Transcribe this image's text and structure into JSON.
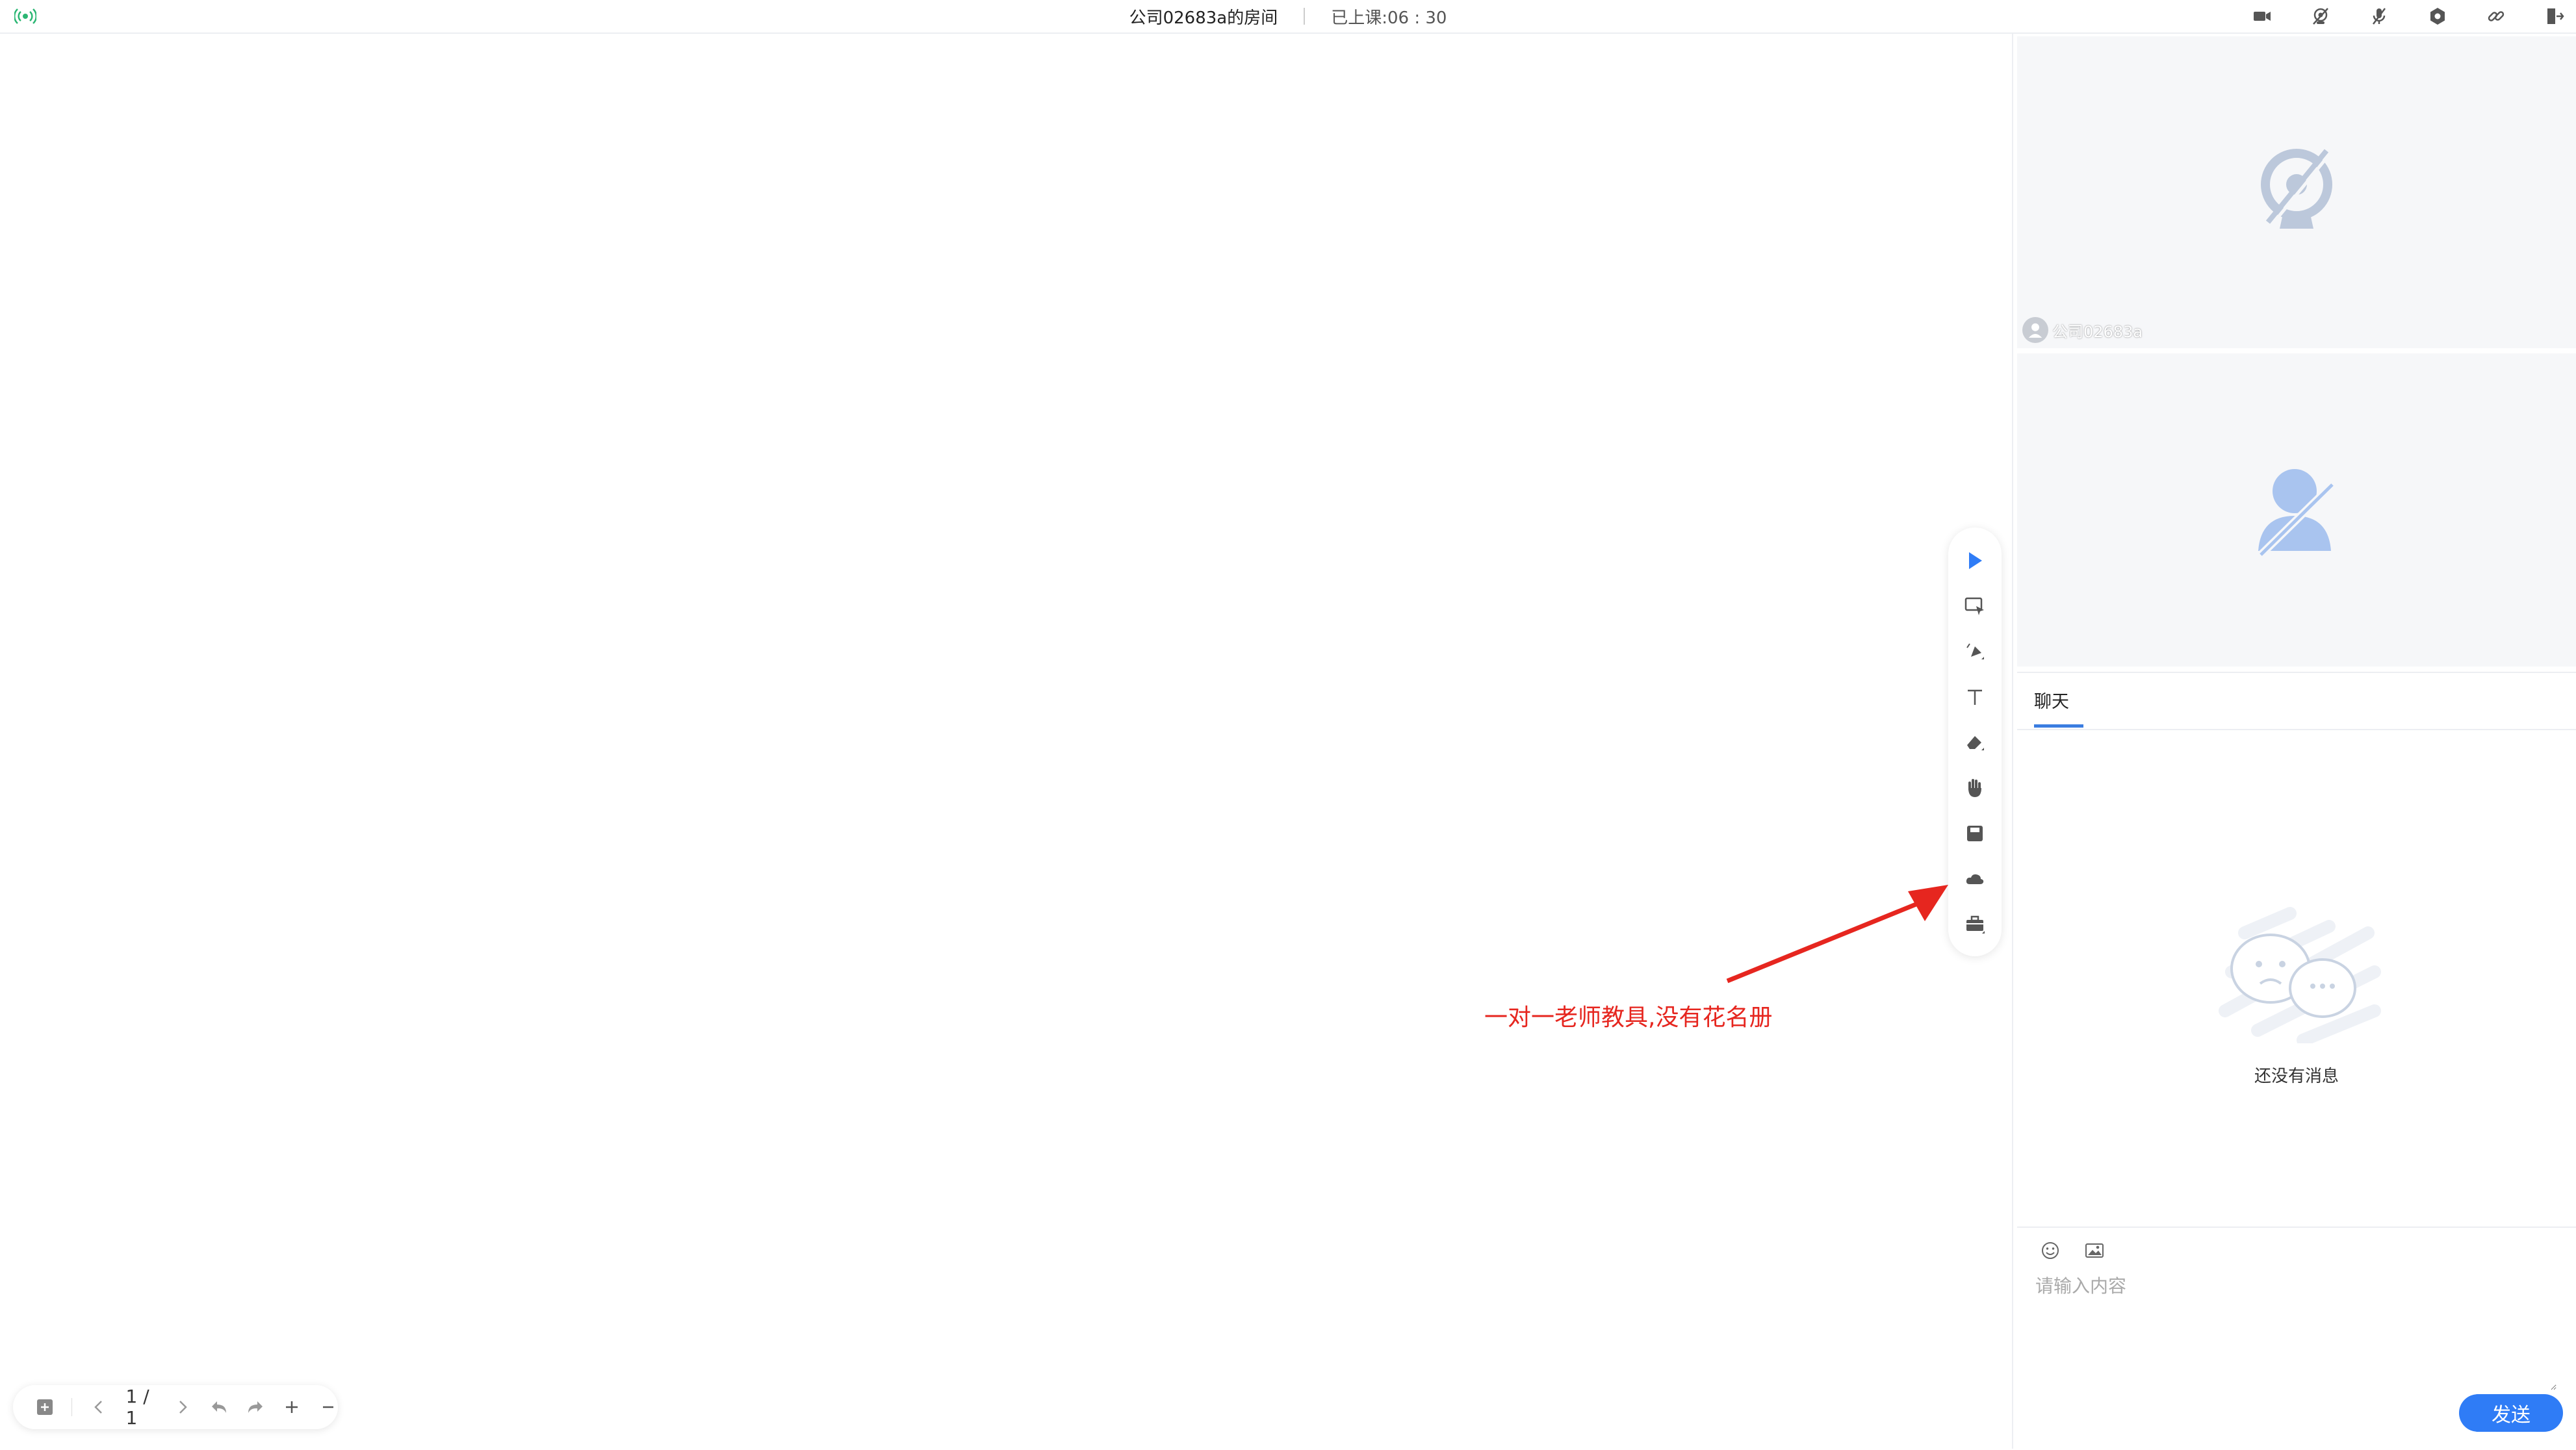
{
  "header": {
    "room_title": "公司02683a的房间",
    "timer_label": "已上课:06 : 30",
    "icons": [
      "signal-icon",
      "camera-icon",
      "camera-off-icon",
      "mic-off-icon",
      "settings-icon",
      "link-icon",
      "exit-icon"
    ]
  },
  "whiteboard": {
    "toolbar_icons": [
      "pointer-icon",
      "select-icon",
      "pen-icon",
      "text-icon",
      "eraser-icon",
      "hand-icon",
      "save-icon",
      "cloud-icon",
      "toolbox-icon"
    ],
    "annotation": "一对一老师教具,没有花名册",
    "pager": {
      "page_text": "1 / 1"
    }
  },
  "videos": [
    {
      "name": "公司02683a",
      "state_icon": "camera-off-icon"
    },
    {
      "state_icon": "user-off-icon"
    }
  ],
  "chat": {
    "tab_label": "聊天",
    "empty_text": "还没有消息",
    "input_placeholder": "请输入内容",
    "send_label": "发送"
  },
  "colors": {
    "accent": "#2f7cf6",
    "annotation_red": "#e6261f",
    "panel_bg": "#f6f7f9"
  }
}
